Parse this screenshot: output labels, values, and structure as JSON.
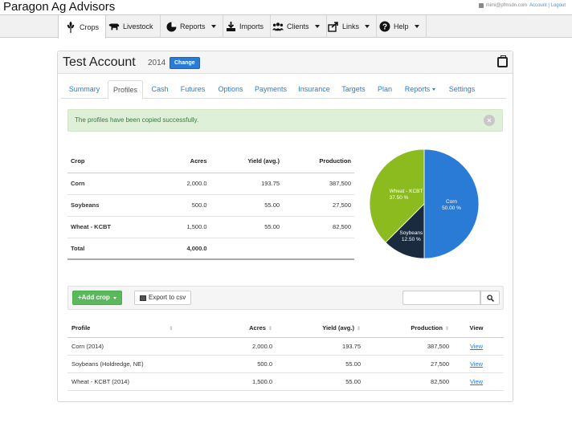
{
  "app": {
    "brand": "Paragon Ag Advisors",
    "user_email": "mimi@pfmsdn.com",
    "account_link": "Account | Logout"
  },
  "nav": [
    {
      "label": "Crops",
      "icon": "wheat-icon",
      "dropdown": false,
      "active": true
    },
    {
      "label": "Livestock",
      "icon": "cow-icon",
      "dropdown": false,
      "active": false
    },
    {
      "label": "Reports",
      "icon": "pie-chart-icon",
      "dropdown": true,
      "active": false
    },
    {
      "label": "Imports",
      "icon": "import-icon",
      "dropdown": false,
      "active": false
    },
    {
      "label": "Clients",
      "icon": "users-icon",
      "dropdown": true,
      "active": false
    },
    {
      "label": "Links",
      "icon": "share-icon",
      "dropdown": true,
      "active": false
    },
    {
      "label": "Help",
      "icon": "question-circle-icon",
      "dropdown": true,
      "active": false
    }
  ],
  "account": {
    "title": "Test Account",
    "year": "2014",
    "change_label": "Change"
  },
  "tabs": [
    {
      "label": "Summary"
    },
    {
      "label": "Profiles"
    },
    {
      "label": "Cash"
    },
    {
      "label": "Futures"
    },
    {
      "label": "Options"
    },
    {
      "label": "Payments"
    },
    {
      "label": "Insurance"
    },
    {
      "label": "Targets"
    },
    {
      "label": "Plan"
    },
    {
      "label": "Reports"
    },
    {
      "label": "Settings"
    }
  ],
  "active_tab": "Profiles",
  "alert": {
    "message": "The profiles have been copied successfully.",
    "close": "×"
  },
  "summary": {
    "headers": [
      "Crop",
      "Acres",
      "Yield (avg.)",
      "Production"
    ],
    "rows": [
      [
        "Corn",
        "2,000.0",
        "193.75",
        "387,500"
      ],
      [
        "Soybeans",
        "500.0",
        "55.00",
        "27,500"
      ],
      [
        "Wheat - KCBT",
        "1,500.0",
        "55.00",
        "82,500"
      ]
    ],
    "total": [
      "Total",
      "4,000.0",
      "",
      ""
    ]
  },
  "chart_data": {
    "type": "pie",
    "slices": [
      {
        "label": "Corn",
        "pct_label": "50.00 %",
        "value": 50.0,
        "color": "#2a7bd6"
      },
      {
        "label": "Soybeans",
        "pct_label": "12.50 %",
        "value": 12.5,
        "color": "#1a2b3f"
      },
      {
        "label": "Wheat - KCBT",
        "pct_label": "37.50 %",
        "value": 37.5,
        "color": "#8cbb20"
      }
    ]
  },
  "toolbar": {
    "add_crop_label": "+Add crop",
    "export_label": "Export to csv",
    "search_placeholder": ""
  },
  "profiles": {
    "headers": [
      "Profile",
      "Acres",
      "Yield (avg.)",
      "Production",
      "View"
    ],
    "rows": [
      {
        "profile": "Corn (2014)",
        "acres": "2,000.0",
        "yield": "193.75",
        "production": "387,500",
        "view": "View"
      },
      {
        "profile": "Soybeans (Holdredge, NE)",
        "acres": "500.0",
        "yield": "55.00",
        "production": "27,500",
        "view": "View"
      },
      {
        "profile": "Wheat - KCBT (2014)",
        "acres": "1,500.0",
        "yield": "55.00",
        "production": "82,500",
        "view": "View"
      }
    ]
  }
}
